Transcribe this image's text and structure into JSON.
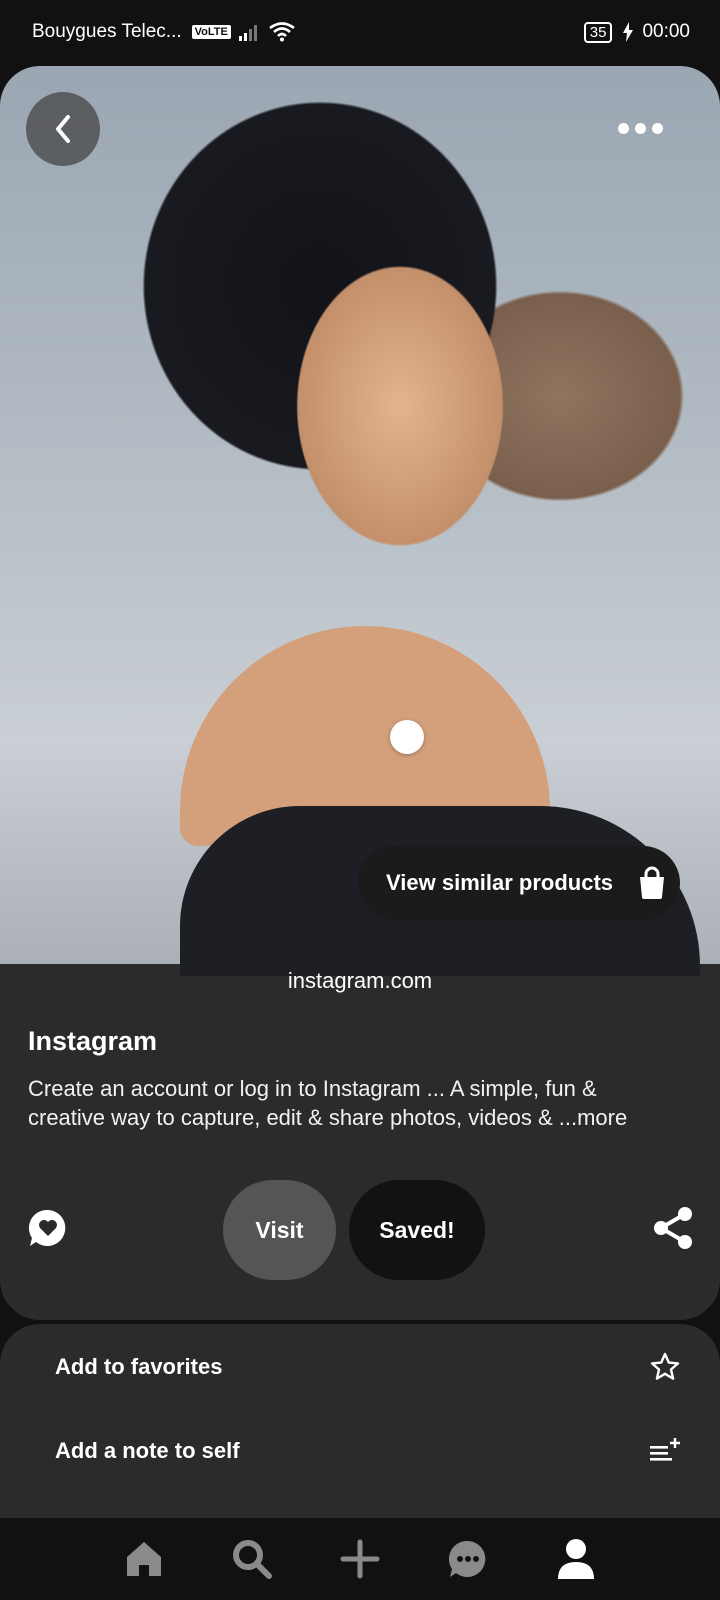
{
  "status_bar": {
    "carrier": "Bouygues Telec...",
    "volte_badge": "VoLTE",
    "battery": "35",
    "time": "00:00"
  },
  "pin": {
    "similar_products_label": "View similar products",
    "source": "instagram.com",
    "title": "Instagram",
    "description": "Create an account or log in to Instagram ... A simple, fun & creative way to capture, edit & share photos, videos & ...more",
    "visit_label": "Visit",
    "saved_label": "Saved!"
  },
  "actions_sheet": {
    "items": [
      {
        "label": "Add to favorites",
        "icon": "star-outline-icon"
      },
      {
        "label": "Add a note to self",
        "icon": "note-add-icon"
      }
    ]
  },
  "bottom_nav": {
    "items": [
      {
        "icon": "home-icon"
      },
      {
        "icon": "search-icon"
      },
      {
        "icon": "plus-icon"
      },
      {
        "icon": "messages-icon"
      },
      {
        "icon": "profile-icon"
      }
    ]
  },
  "colors": {
    "background": "#111111",
    "card": "#2b2b2b",
    "visit_button": "#555555",
    "saved_button": "#121212"
  }
}
